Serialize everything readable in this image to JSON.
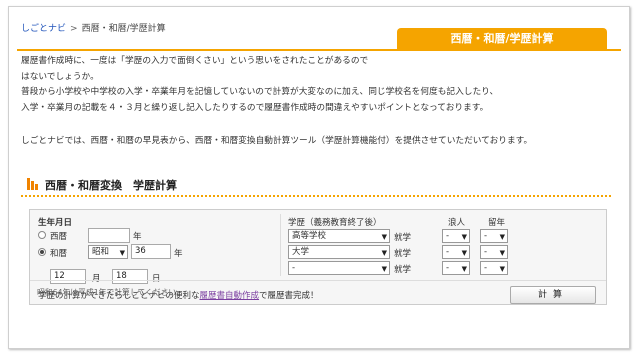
{
  "breadcrumb": {
    "home": "しごとナビ",
    "sep": ">",
    "current": "西暦・和暦/学歴計算"
  },
  "tab_title": "西暦・和暦/学歴計算",
  "intro": {
    "line1": "履歴書作成時に、一度は「学歴の入力で面倒くさい」という思いをされたことがあるので",
    "line2": "はないでしょうか。",
    "line3": "普段から小学校や中学校の入学・卒業年月を記憶していないので計算が大変なのに加え、同じ学校名を何度も記入したり、",
    "line4": "入学・卒業月の記載を４・３月と繰り返し記入したりするので履歴書作成時の間違えやすいポイントとなっております。",
    "line5": "しごとナビでは、西暦・和暦の早見表から、西暦・和暦変換自動計算ツール（学歴計算機能付）を提供させていただいております。"
  },
  "section_title": "西暦・和暦変換　学歴計算",
  "form": {
    "birth_label": "生年月日",
    "seireki_label": "西暦",
    "seireki_value": "",
    "year_suffix": "年",
    "wareki_label": "和暦",
    "era_value": "昭和",
    "wareki_year": "36",
    "month_value": "12",
    "month_suffix": "月",
    "day_value": "18",
    "day_suffix": "日",
    "note": "昭和64年は平成1年で計算してください。",
    "education_label": "学歴（義務教育終了後）",
    "ronin_label": "浪人",
    "ryunen_label": "留年",
    "enter_label": "就学",
    "rows": [
      {
        "school": "高等学校",
        "ronin": "-",
        "ryunen": "-"
      },
      {
        "school": "大学",
        "ronin": "-",
        "ryunen": "-"
      },
      {
        "school": "-",
        "ronin": "-",
        "ryunen": "-"
      }
    ],
    "arrow": "▼"
  },
  "footer": {
    "text_before": "学歴の計算ができたらしごとナビの便利な",
    "link": "履歴書自動作成",
    "text_after": "で履歴書完成！",
    "calc_button": "計算"
  },
  "colors": {
    "accent": "#f5a400",
    "link": "#2255bb"
  }
}
